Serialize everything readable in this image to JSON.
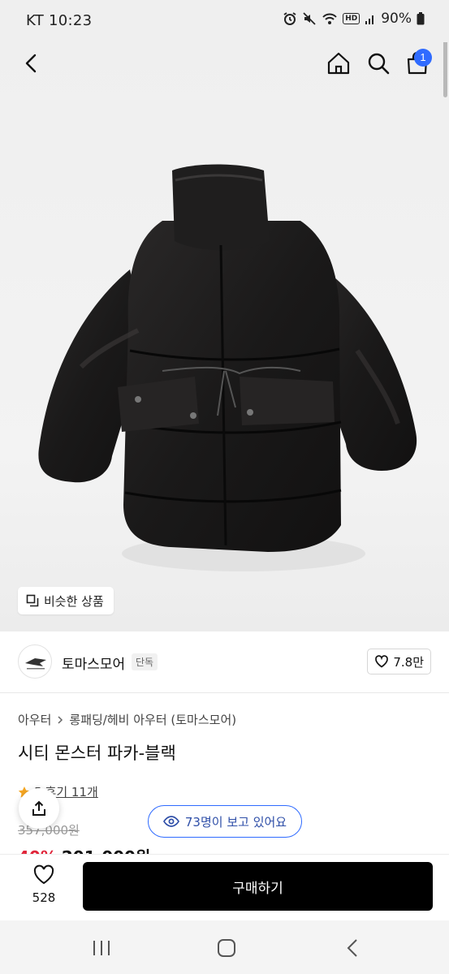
{
  "status_bar": {
    "carrier_time": "KT 10:23",
    "battery": "90%",
    "hd_label": "HD"
  },
  "nav": {
    "cart_count": "1"
  },
  "similar_button": {
    "label": "비슷한 상품"
  },
  "brand": {
    "name": "토마스모어",
    "tag": "단독",
    "likes": "7.8만"
  },
  "product": {
    "breadcrumb": [
      "아우터",
      "롱패딩/헤비 아우터 (토마스모어)"
    ],
    "title": "시티 몬스터 파카-블랙",
    "rating": "5",
    "review_label": "후기 11개",
    "original_price": "357,000원",
    "discount": "40%",
    "sale_price": "201,000원"
  },
  "viewers": {
    "label": "73명이 보고 있어요"
  },
  "purchase_bar": {
    "wish_count": "528",
    "buy_label": "구매하기"
  },
  "colors": {
    "accent_blue": "#2f6bff",
    "sale_red": "#e0253a",
    "buy_black": "#000000"
  },
  "icons": [
    "alarm-icon",
    "mute-icon",
    "wifi-icon",
    "signal-icon",
    "battery-icon",
    "back-icon",
    "home-icon",
    "search-icon",
    "cart-icon",
    "similar-icon",
    "heart-icon",
    "share-icon",
    "star-icon",
    "eye-icon",
    "recent-apps-icon",
    "home-nav-icon",
    "back-nav-icon"
  ]
}
